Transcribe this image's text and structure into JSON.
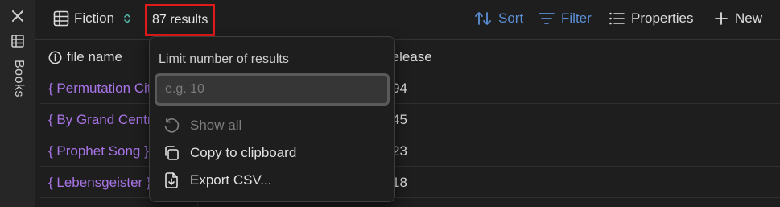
{
  "sidebar": {
    "label": "Books"
  },
  "toolbar": {
    "view_label": "Fiction",
    "results_label": "87 results",
    "sort_label": "Sort",
    "filter_label": "Filter",
    "properties_label": "Properties",
    "new_label": "New"
  },
  "table": {
    "columns": [
      "file name",
      "release"
    ],
    "rows": [
      {
        "name": "{ Permutation City }",
        "year": "94"
      },
      {
        "name": "{ By Grand Central Station }",
        "year": "45"
      },
      {
        "name": "{ Prophet Song }",
        "year": "23"
      },
      {
        "name": "{ Lebensgeister }",
        "year": "18"
      }
    ]
  },
  "popover": {
    "title": "Limit number of results",
    "input_placeholder": "e.g. 10",
    "input_value": "",
    "items": [
      {
        "label": "Show all",
        "icon": "reset-icon",
        "disabled": true
      },
      {
        "label": "Copy to clipboard",
        "icon": "copy-icon",
        "disabled": false
      },
      {
        "label": "Export CSV...",
        "icon": "export-icon",
        "disabled": false
      }
    ]
  },
  "colors": {
    "accent_blue": "#5b8fd6",
    "link_purple": "#a874e6",
    "highlight_red": "#e31a1a",
    "background": "#1e1e1e"
  }
}
